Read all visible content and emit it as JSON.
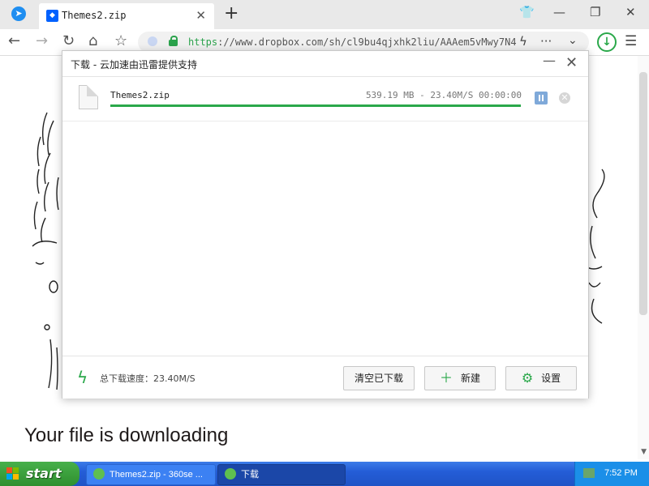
{
  "browser": {
    "tab": {
      "title": "Themes2.zip"
    },
    "url": {
      "scheme": "https",
      "rest": "://www.dropbox.com/sh/cl9bu4qjxhk2liu/AAAem5vMwy7N4"
    }
  },
  "page": {
    "headline": "Your file is downloading"
  },
  "dialog": {
    "title": "下载 - 云加速由迅雷提供支持",
    "item": {
      "file_name": "Themes2.zip",
      "meta": "539.19 MB - 23.40M/S 00:00:00",
      "progress": 1.0
    },
    "footer": {
      "speed_label": "总下载速度：23.40M/S",
      "clear_button": "清空已下载",
      "new_button": "新建",
      "settings_button": "设置"
    }
  },
  "taskbar": {
    "start": "start",
    "tasks": [
      {
        "label": "Themes2.zip - 360se ..."
      },
      {
        "label": "下载"
      }
    ],
    "clock": "7:52 PM"
  },
  "colors": {
    "accent_green": "#2aa84a",
    "taskbar_blue": "#245dd7"
  }
}
